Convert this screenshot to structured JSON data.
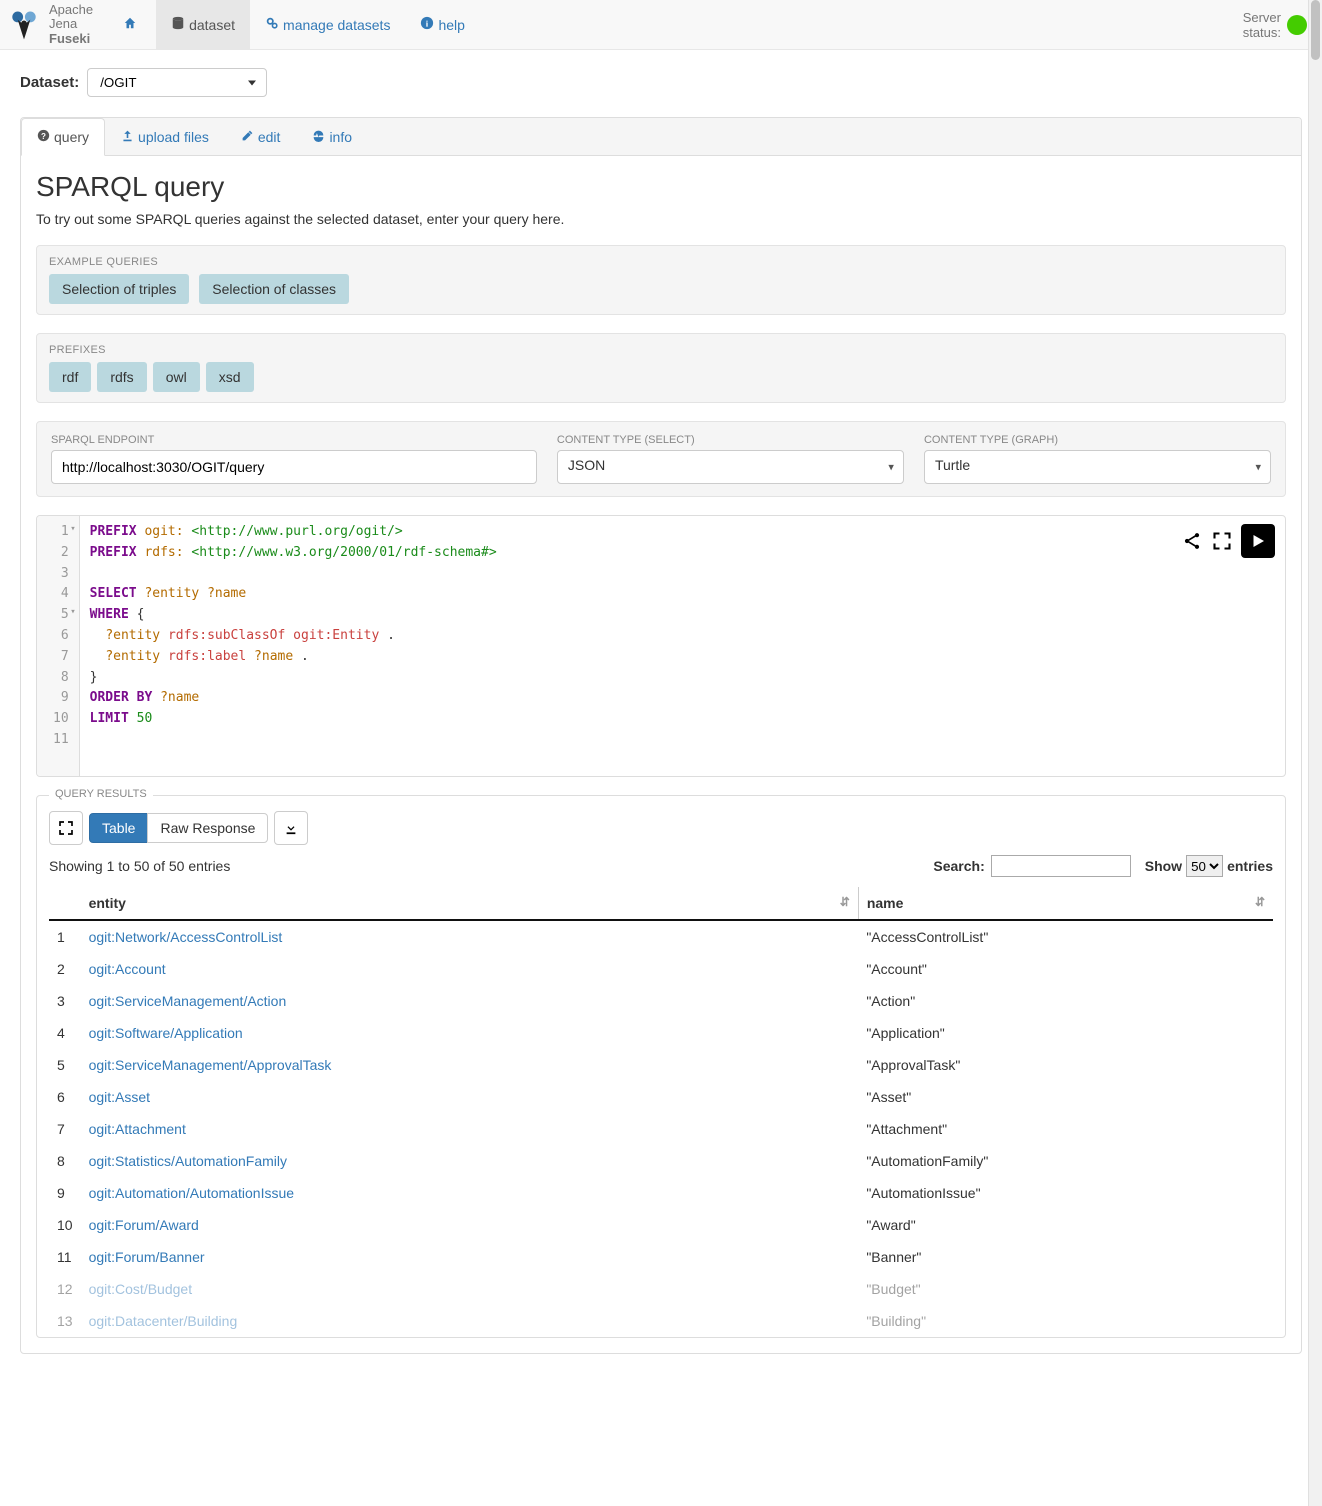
{
  "brand": {
    "l1": "Apache",
    "l2": "Jena",
    "l3": "Fuseki"
  },
  "nav": {
    "home": "",
    "dataset": "dataset",
    "manage": "manage datasets",
    "help": "help"
  },
  "status": {
    "label": "Server\nstatus:"
  },
  "dataset_picker": {
    "label": "Dataset:",
    "value": "/OGIT"
  },
  "tabs": {
    "query": "query",
    "upload": "upload files",
    "edit": "edit",
    "info": "info"
  },
  "page": {
    "title": "SPARQL query",
    "lead": "To try out some SPARQL queries against the selected dataset, enter your query here."
  },
  "examples": {
    "label": "EXAMPLE QUERIES",
    "triples": "Selection of triples",
    "classes": "Selection of classes"
  },
  "prefixes": {
    "label": "PREFIXES",
    "items": [
      "rdf",
      "rdfs",
      "owl",
      "xsd"
    ]
  },
  "endpoint": {
    "label": "SPARQL ENDPOINT",
    "value": "http://localhost:3030/OGIT/query"
  },
  "content_select": {
    "label": "CONTENT TYPE (SELECT)",
    "value": "JSON"
  },
  "content_graph": {
    "label": "CONTENT TYPE (GRAPH)",
    "value": "Turtle"
  },
  "editor": {
    "lines": 11
  },
  "results": {
    "legend": "QUERY RESULTS",
    "view_table": "Table",
    "view_raw": "Raw Response",
    "info": "Showing 1 to 50 of 50 entries",
    "search_label": "Search:",
    "show_prefix": "Show",
    "show_value": "50",
    "show_suffix": "entries",
    "columns": {
      "entity": "entity",
      "name": "name"
    },
    "rows": [
      {
        "n": "1",
        "entity": "ogit:Network/AccessControlList",
        "name": "\"AccessControlList\""
      },
      {
        "n": "2",
        "entity": "ogit:Account",
        "name": "\"Account\""
      },
      {
        "n": "3",
        "entity": "ogit:ServiceManagement/Action",
        "name": "\"Action\""
      },
      {
        "n": "4",
        "entity": "ogit:Software/Application",
        "name": "\"Application\""
      },
      {
        "n": "5",
        "entity": "ogit:ServiceManagement/ApprovalTask",
        "name": "\"ApprovalTask\""
      },
      {
        "n": "6",
        "entity": "ogit:Asset",
        "name": "\"Asset\""
      },
      {
        "n": "7",
        "entity": "ogit:Attachment",
        "name": "\"Attachment\""
      },
      {
        "n": "8",
        "entity": "ogit:Statistics/AutomationFamily",
        "name": "\"AutomationFamily\""
      },
      {
        "n": "9",
        "entity": "ogit:Automation/AutomationIssue",
        "name": "\"AutomationIssue\""
      },
      {
        "n": "10",
        "entity": "ogit:Forum/Award",
        "name": "\"Award\""
      },
      {
        "n": "11",
        "entity": "ogit:Forum/Banner",
        "name": "\"Banner\""
      },
      {
        "n": "12",
        "entity": "ogit:Cost/Budget",
        "name": "\"Budget\"",
        "faded": true
      },
      {
        "n": "13",
        "entity": "ogit:Datacenter/Building",
        "name": "\"Building\"",
        "faded": true
      }
    ]
  }
}
